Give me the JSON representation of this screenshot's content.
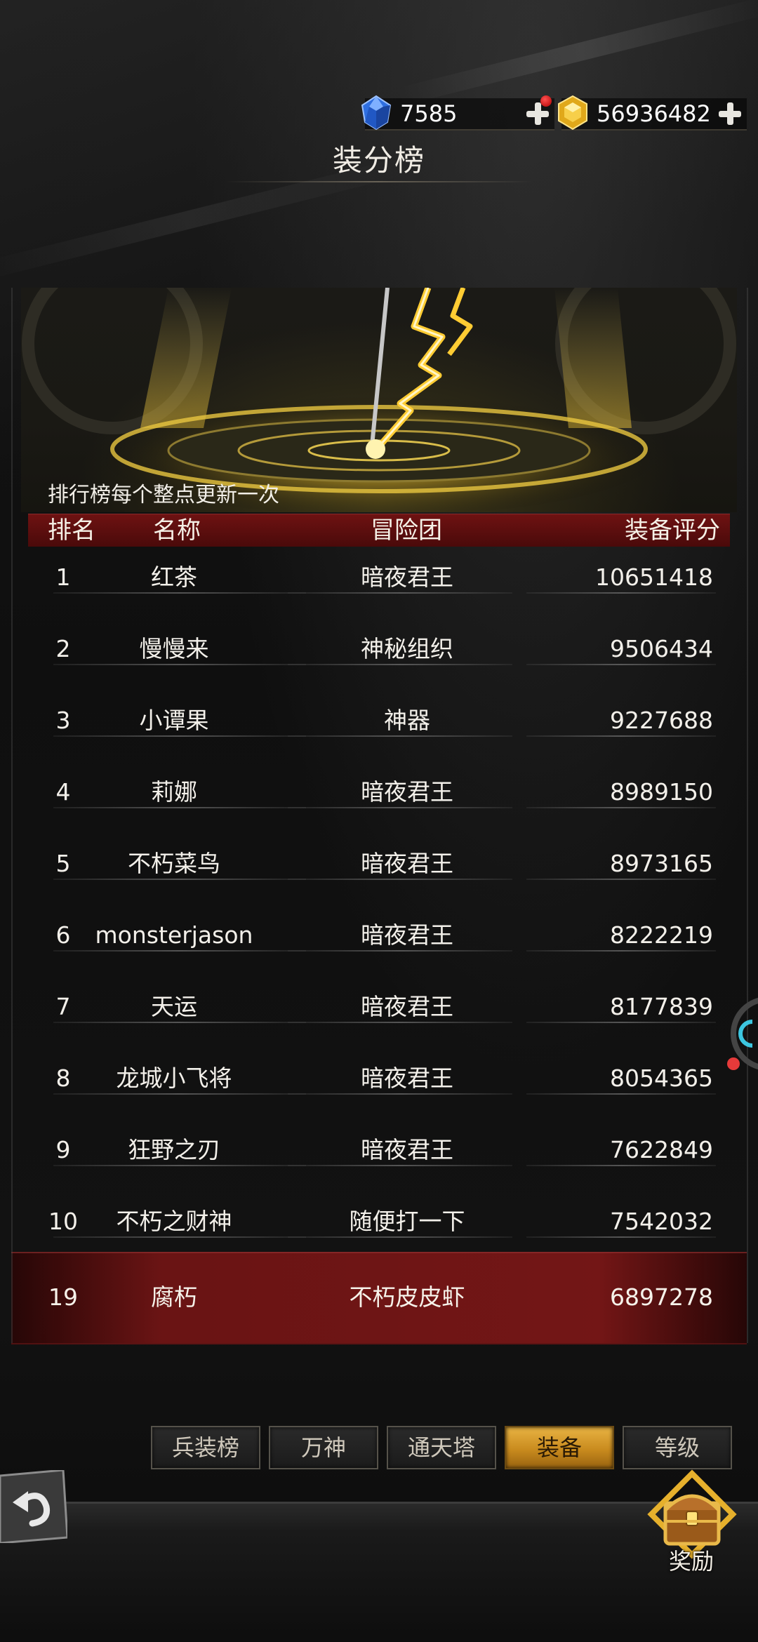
{
  "currency": {
    "diamond": "7585",
    "gold": "56936482"
  },
  "title": "装分榜",
  "notice": "排行榜每个整点更新一次",
  "table": {
    "headers": {
      "rank": "排名",
      "name": "名称",
      "guild": "冒险团",
      "score": "装备评分"
    },
    "rows": [
      {
        "rank": "1",
        "name": "红茶",
        "guild": "暗夜君王",
        "score": "10651418"
      },
      {
        "rank": "2",
        "name": "慢慢来",
        "guild": "神秘组织",
        "score": "9506434"
      },
      {
        "rank": "3",
        "name": "小谭果",
        "guild": "神器",
        "score": "9227688"
      },
      {
        "rank": "4",
        "name": "莉娜",
        "guild": "暗夜君王",
        "score": "8989150"
      },
      {
        "rank": "5",
        "name": "不朽菜鸟",
        "guild": "暗夜君王",
        "score": "8973165"
      },
      {
        "rank": "6",
        "name": "monsterjason",
        "guild": "暗夜君王",
        "score": "8222219"
      },
      {
        "rank": "7",
        "name": "天运",
        "guild": "暗夜君王",
        "score": "8177839"
      },
      {
        "rank": "8",
        "name": "龙城小飞将",
        "guild": "暗夜君王",
        "score": "8054365"
      },
      {
        "rank": "9",
        "name": "狂野之刃",
        "guild": "暗夜君王",
        "score": "7622849"
      },
      {
        "rank": "10",
        "name": "不朽之财神",
        "guild": "随便打一下",
        "score": "7542032"
      }
    ],
    "my_row": {
      "rank": "19",
      "name": "腐朽",
      "guild": "不朽皮皮虾",
      "score": "6897278"
    }
  },
  "tabs": [
    {
      "label": "兵装榜",
      "active": false
    },
    {
      "label": "万神",
      "active": false
    },
    {
      "label": "通天塔",
      "active": false
    },
    {
      "label": "装备",
      "active": true
    },
    {
      "label": "等级",
      "active": false
    }
  ],
  "reward_label": "奖励",
  "colors": {
    "header_red": "#6e1212",
    "active_tab_gold": "#e8b343",
    "my_row_red": "#781616"
  }
}
